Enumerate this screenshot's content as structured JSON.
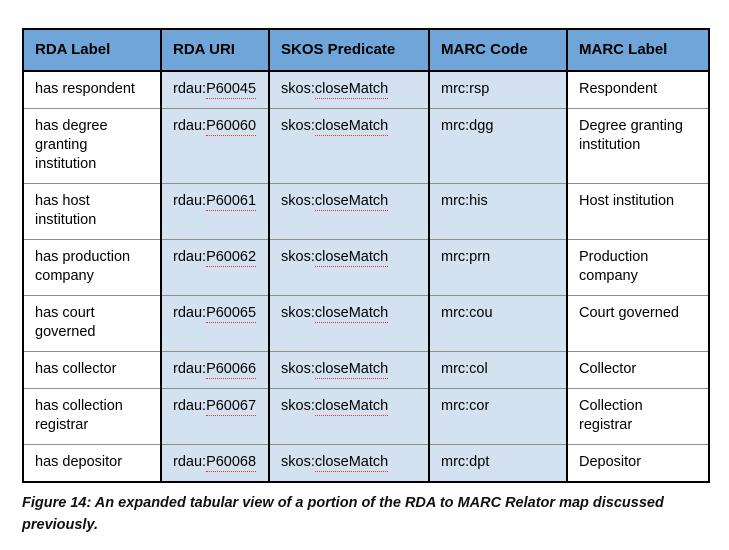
{
  "figure": {
    "caption": "Figure 14: An expanded tabular view of a portion of the RDA to MARC Relator map discussed previously."
  },
  "table": {
    "columns": [
      {
        "key": "rda_label",
        "label": "RDA Label",
        "shaded": false
      },
      {
        "key": "rda_uri",
        "label": "RDA URI",
        "shaded": true
      },
      {
        "key": "skos",
        "label": "SKOS Predicate",
        "shaded": true
      },
      {
        "key": "marc_code",
        "label": "MARC Code",
        "shaded": true
      },
      {
        "key": "marc_label",
        "label": "MARC Label",
        "shaded": false
      }
    ],
    "header_background": "#6fa5d8",
    "shaded_background": "#d3e1f1",
    "rows": [
      {
        "rda_label": "has respondent",
        "rda_uri_prefix": "rdau:",
        "rda_uri_id": "P60045",
        "skos_prefix": "skos:",
        "skos_term": "closeMatch",
        "marc_code": "mrc:rsp",
        "marc_label": "Respondent"
      },
      {
        "rda_label": "has degree granting institution",
        "rda_uri_prefix": "rdau:",
        "rda_uri_id": "P60060",
        "skos_prefix": "skos:",
        "skos_term": "closeMatch",
        "marc_code": "mrc:dgg",
        "marc_label": "Degree granting institution"
      },
      {
        "rda_label": "has host institution",
        "rda_uri_prefix": "rdau:",
        "rda_uri_id": "P60061",
        "skos_prefix": "skos:",
        "skos_term": "closeMatch",
        "marc_code": "mrc:his",
        "marc_label": "Host institution"
      },
      {
        "rda_label": "has production company",
        "rda_uri_prefix": "rdau:",
        "rda_uri_id": "P60062",
        "skos_prefix": "skos:",
        "skos_term": "closeMatch",
        "marc_code": "mrc:prn",
        "marc_label": "Production company"
      },
      {
        "rda_label": "has court governed",
        "rda_uri_prefix": "rdau:",
        "rda_uri_id": "P60065",
        "skos_prefix": "skos:",
        "skos_term": "closeMatch",
        "marc_code": "mrc:cou",
        "marc_label": "Court governed"
      },
      {
        "rda_label": "has collector",
        "rda_uri_prefix": "rdau:",
        "rda_uri_id": "P60066",
        "skos_prefix": "skos:",
        "skos_term": "closeMatch",
        "marc_code": "mrc:col",
        "marc_label": "Collector"
      },
      {
        "rda_label": "has collection registrar",
        "rda_uri_prefix": "rdau:",
        "rda_uri_id": "P60067",
        "skos_prefix": "skos:",
        "skos_term": "closeMatch",
        "marc_code": "mrc:cor",
        "marc_label": "Collection registrar"
      },
      {
        "rda_label": "has depositor",
        "rda_uri_prefix": "rdau:",
        "rda_uri_id": "P60068",
        "skos_prefix": "skos:",
        "skos_term": "closeMatch",
        "marc_code": "mrc:dpt",
        "marc_label": "Depositor"
      }
    ]
  }
}
